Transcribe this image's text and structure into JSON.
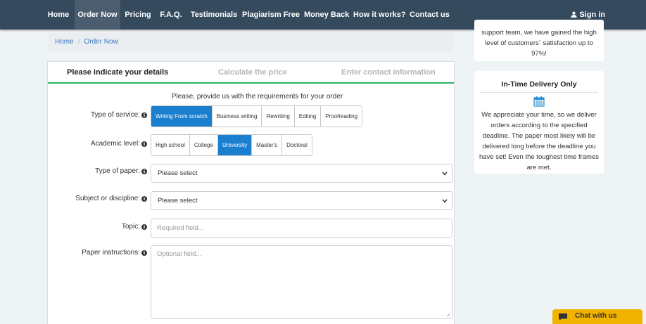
{
  "nav": {
    "items": [
      {
        "label": "Home"
      },
      {
        "label": "Order Now",
        "active": true
      },
      {
        "label": "Pricing"
      },
      {
        "label": "F.A.Q."
      },
      {
        "label": "Testimonials"
      },
      {
        "label": "Plagiarism Free"
      },
      {
        "label": "Money Back"
      },
      {
        "label": "How it works?"
      },
      {
        "label": "Contact us"
      }
    ],
    "signin": "Sign in"
  },
  "breadcrumb": {
    "home": "Home",
    "separator": "/",
    "current": "Order Now"
  },
  "steps": [
    "Please indicate your details",
    "Calculate the price",
    "Enter contact information"
  ],
  "form": {
    "intro": "Please, provide us with the requirements for your order",
    "service": {
      "label": "Type of service:",
      "options": [
        "Writing From scratch",
        "Business writing",
        "Rewriting",
        "Editing",
        "Proofreading"
      ],
      "selected": "Writing From scratch"
    },
    "level": {
      "label": "Academic level:",
      "options": [
        "High school",
        "College",
        "University",
        "Master's",
        "Doctoral"
      ],
      "selected": "University"
    },
    "paper_type": {
      "label": "Type of paper:",
      "value": "Please select"
    },
    "subject": {
      "label": "Subject or discipline:",
      "value": "Please select"
    },
    "topic": {
      "label": "Topic:",
      "placeholder": "Required field..."
    },
    "instructions": {
      "label": "Paper instructions:",
      "placeholder": "Optional field..."
    }
  },
  "sidebar": {
    "card1": {
      "lines": [
        "support team, we have gained the high",
        "level of customers` satisfaction up to",
        "97%!"
      ]
    },
    "card2": {
      "title": "In-Time Delivery Only",
      "lines": [
        "We appreciate your time, so we deliver",
        "orders according to the specified",
        "deadline. The paper most likely will be",
        "delivered long before the deadline you",
        "have set! Even the toughest time frames",
        "are met."
      ]
    }
  },
  "chat": {
    "label": "Chat with us"
  },
  "colors": {
    "nav_bg": "#354a5d",
    "accent_blue": "#1b7fcf",
    "step_underline": "#2db35d",
    "chat_bg": "#f0b400"
  }
}
